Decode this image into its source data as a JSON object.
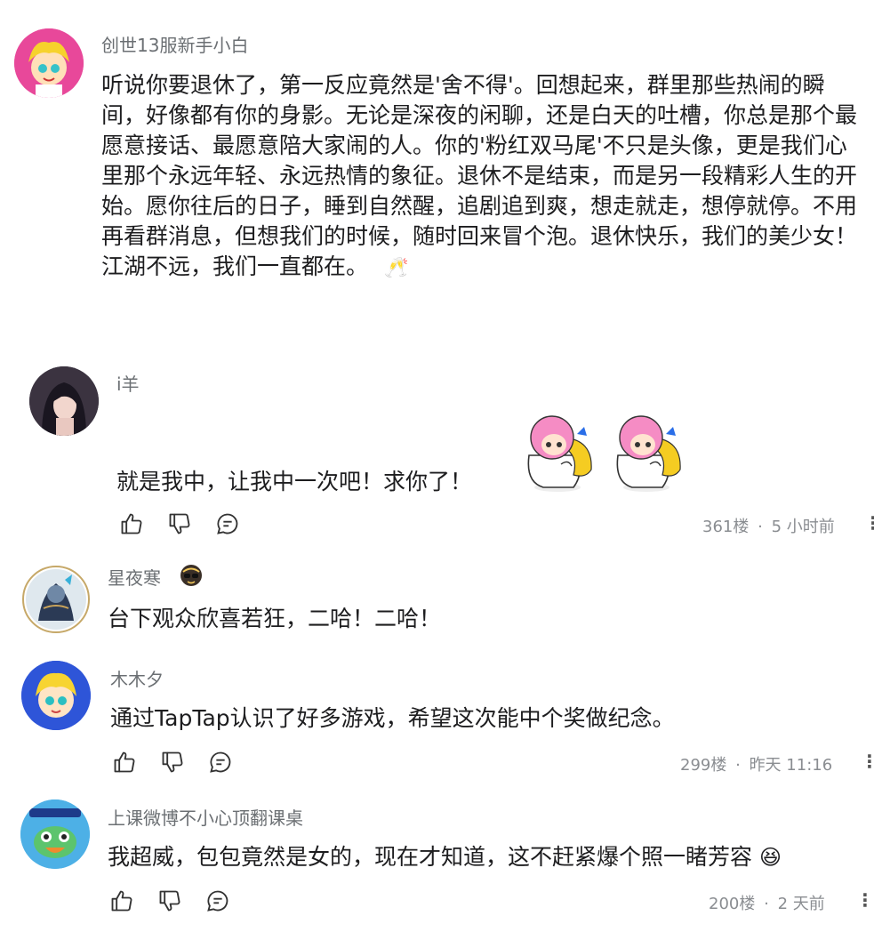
{
  "comments": [
    {
      "username": "创世13服新手小白",
      "text": "听说你要退休了，第一反应竟然是'舍不得'。回想起来，群里那些热闹的瞬间，好像都有你的身影。无论是深夜的闲聊，还是白天的吐槽，你总是那个最愿意接话、最愿意陪大家闹的人。你的'粉红双马尾'不只是头像，更是我们心里那个永远年轻、永远热情的象征。退休不是结束，而是另一段精彩人生的开始。愿你往后的日子，睡到自然醒，追剧追到爽，想走就走，想停就停。不用再看群消息，但想我们的时候，随时回来冒个泡。退休快乐，我们的美少女！江湖不远，我们一直都在。",
      "emoji": "🥂"
    },
    {
      "username": "i羊",
      "text": "就是我中，让我中一次吧！求你了！",
      "sticker_count": 2,
      "floor": "361楼",
      "time": "5 小时前"
    },
    {
      "username": "星夜寒",
      "badge_icon": "sunglasses-badge-icon",
      "text": "台下观众欣喜若狂，二哈！二哈！"
    },
    {
      "username": "木木夕",
      "text": "通过TapTap认识了好多游戏，希望这次能中个奖做纪念。",
      "floor": "299楼",
      "time": "昨天 11:16"
    },
    {
      "username": "上课微博不小心顶翻课桌",
      "text": "我超威，包包竟然是女的，现在才知道，这不赶紧爆个照一睹芳容",
      "emoji": "😆",
      "floor": "200楼",
      "time": "2 天前"
    }
  ],
  "separator": "·",
  "more_symbol": "⋮",
  "icons": [
    "thumbs-up-icon",
    "thumbs-down-icon",
    "reply-bubble-icon"
  ],
  "colors": {
    "meta_text": "#8a8d91",
    "username": "#6b6f73",
    "body_text": "#1d1d1f"
  }
}
